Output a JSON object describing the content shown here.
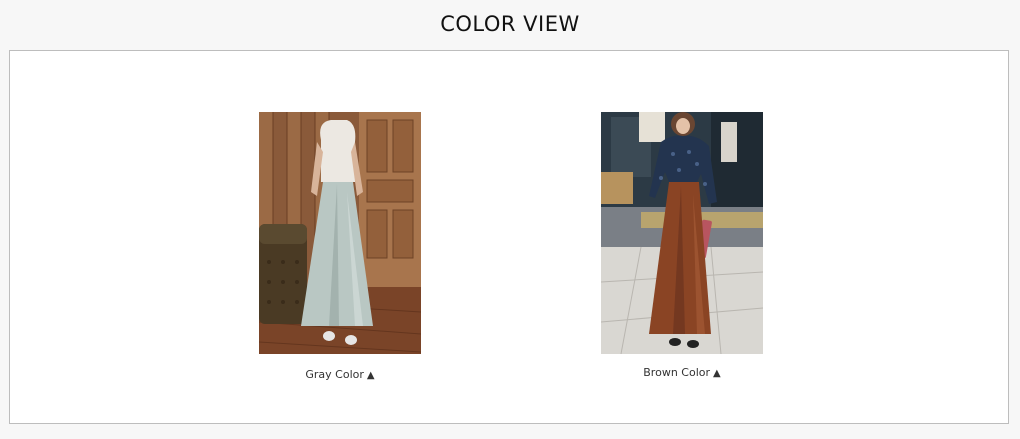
{
  "header": {
    "title": "COLOR VIEW"
  },
  "items": [
    {
      "label": "Gray Color",
      "icon": "triangle-up-icon"
    },
    {
      "label": "Brown Color",
      "icon": "triangle-up-icon"
    }
  ]
}
